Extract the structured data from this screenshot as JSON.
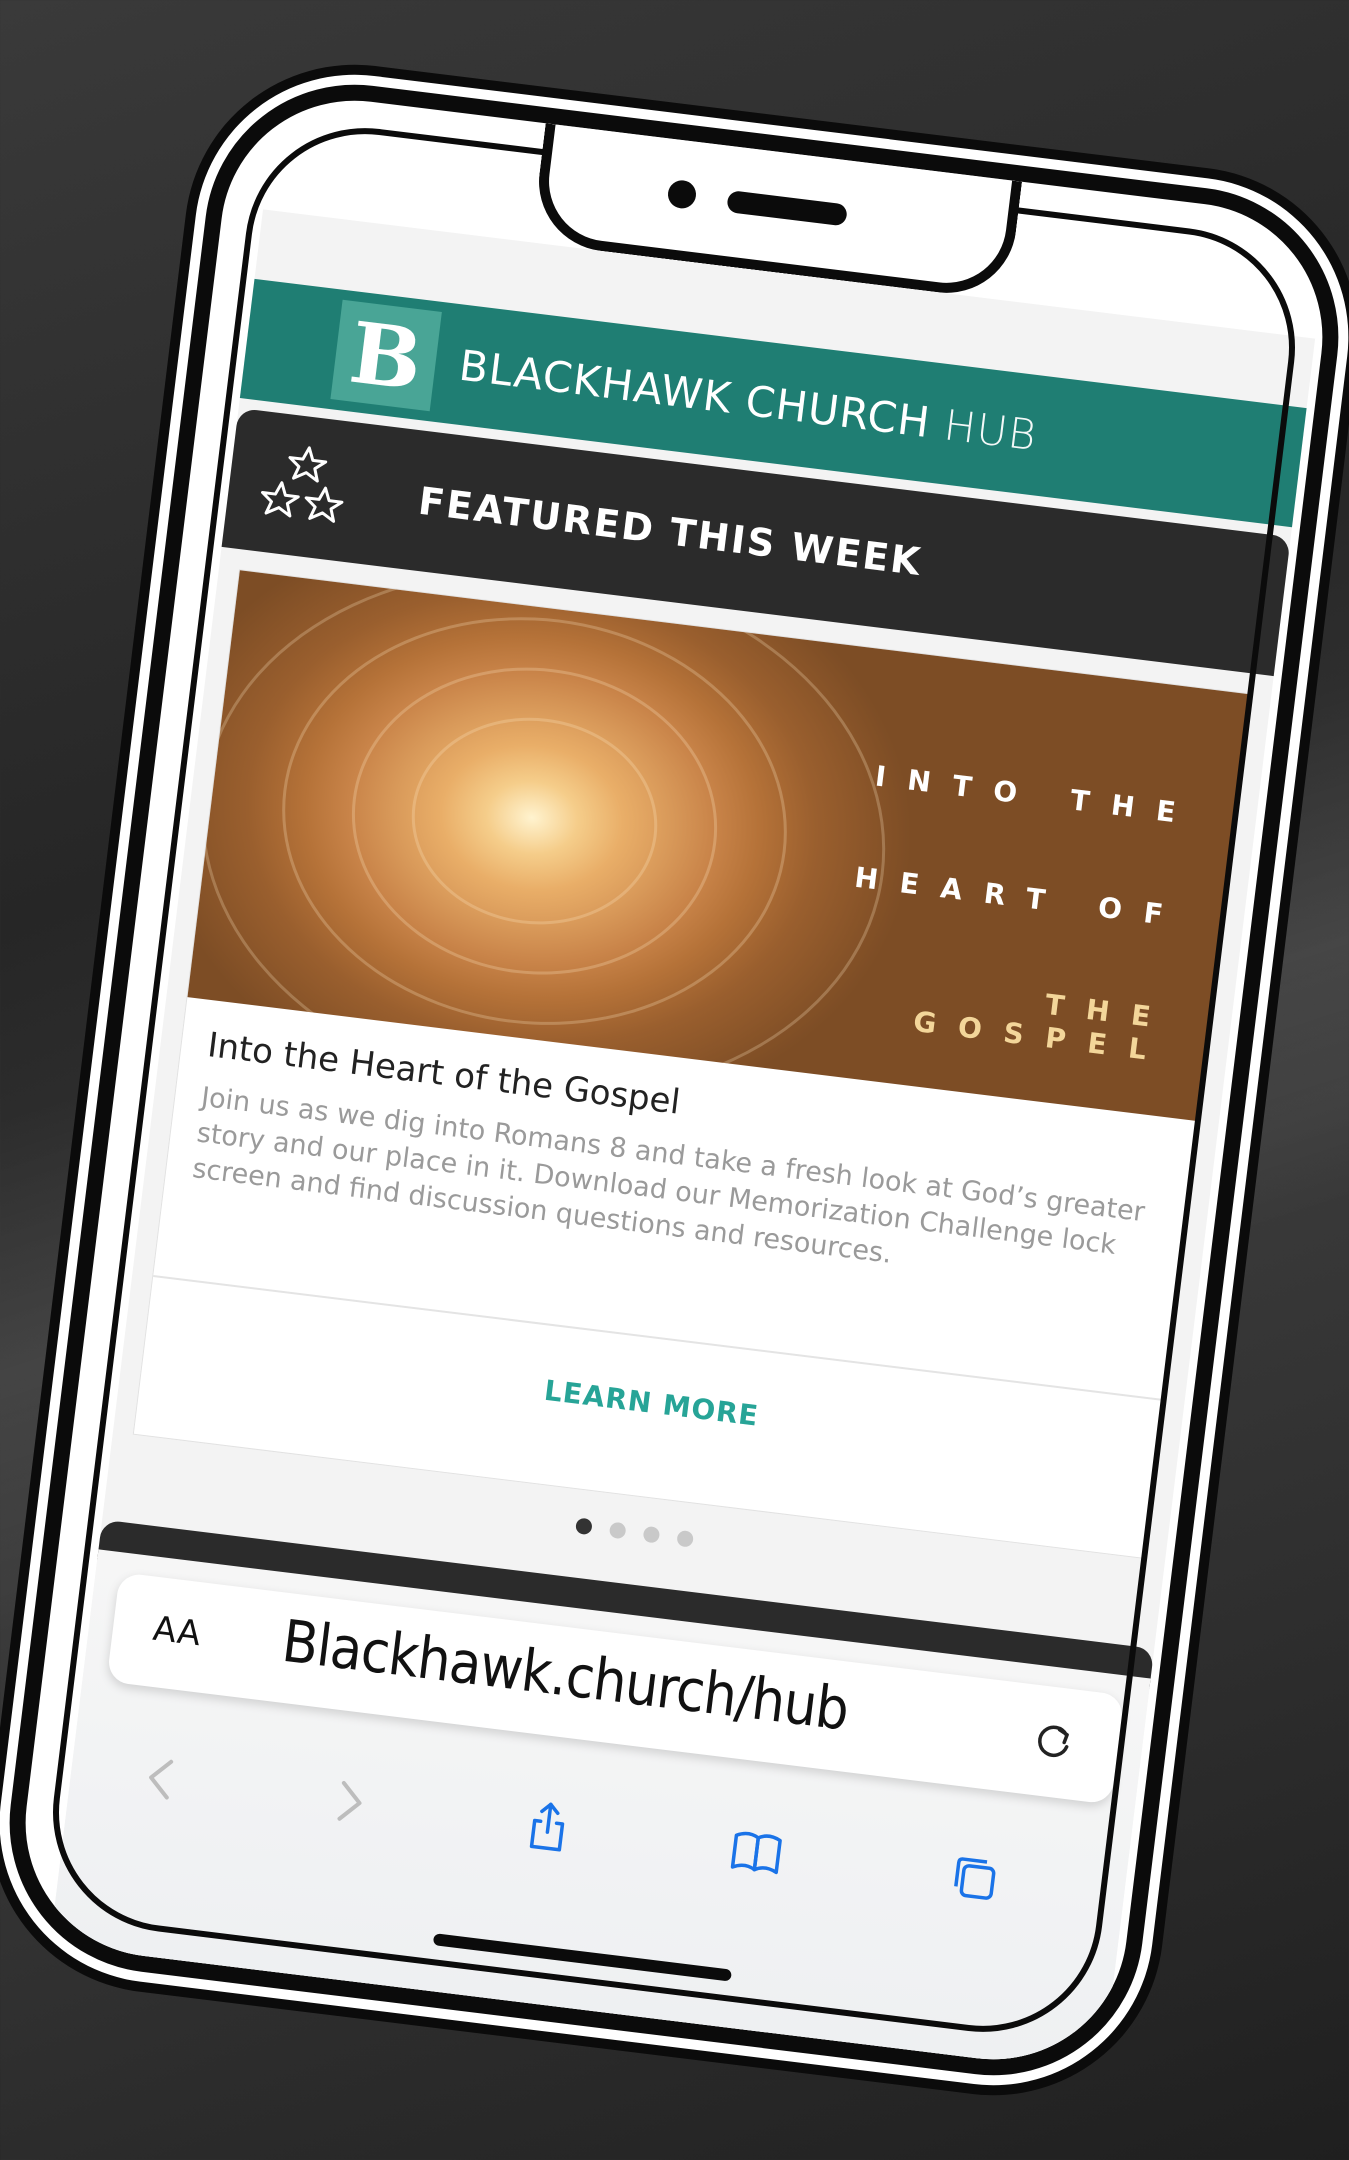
{
  "header": {
    "logo_letter": "B",
    "title": "BLACKHAWK CHURCH",
    "title_suffix": "HUB",
    "brand_color": "#1f7e73"
  },
  "featured": {
    "label": "FEATURED THIS WEEK",
    "icon": "stars-icon"
  },
  "card": {
    "hero_lines": [
      "INTO THE",
      "HEART OF",
      "THE GOSPEL"
    ],
    "title": "Into the Heart of the Gospel",
    "description": "Join us as we dig into Romans 8 and take a fresh look at God’s greater story and our place in it. Download our Memorization Challenge lock screen and find discussion questions and resources.",
    "cta": "LEARN MORE",
    "cta_color": "#27a497"
  },
  "carousel": {
    "total": 4,
    "active_index": 0
  },
  "browser": {
    "text_size_label": "AA",
    "url": "Blackhawk.church/hub",
    "icons": [
      "back-icon",
      "forward-icon",
      "share-icon",
      "bookmarks-icon",
      "tabs-icon",
      "reload-icon"
    ]
  }
}
